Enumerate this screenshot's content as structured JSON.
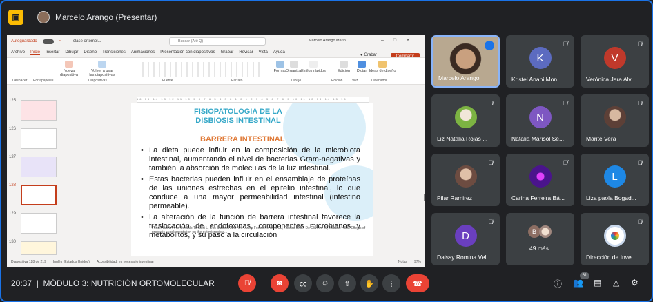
{
  "header": {
    "presenter_title": "Marcelo Arango (Presentar)"
  },
  "ppt": {
    "autosave": "Autoguardado",
    "filename": "clase ortomol...",
    "search_placeholder": "Buscar (Alt+Q)",
    "user": "Marcelo Arango Marin",
    "tabs": [
      "Archivo",
      "Inicio",
      "Insertar",
      "Dibujar",
      "Diseño",
      "Transiciones",
      "Animaciones",
      "Presentación con diapositivas",
      "Grabar",
      "Revisar",
      "Vista",
      "Ayuda"
    ],
    "record": "Grabar",
    "share": "Compartir",
    "ribbon_groups": [
      "Deshacer",
      "Portapapeles",
      "Diapositivas",
      "Fuente",
      "Párrafo",
      "Dibujo",
      "Edición",
      "Voz",
      "Diseñador"
    ],
    "ribbon_items": [
      "Nueva diapositiva",
      "Volver a usar las diapositivas",
      "Formas",
      "Organizar",
      "Estilos rápidos",
      "Edición",
      "Dictar",
      "Ideas de diseño"
    ],
    "slide_numbers": [
      "125",
      "126",
      "127",
      "128",
      "129",
      "130"
    ],
    "status": "Diapositiva 128 de 219",
    "status_lang": "Inglés (Estados Unidos)",
    "status_access": "Accesibilidad: es necesario investigar",
    "status_notes": "Notas",
    "zoom": "97%"
  },
  "slide": {
    "title_line1": "FISIOPATOLOGIA DE LA",
    "title_line2": "DISBIOSIS INTESTINAL",
    "subtitle": "BARRERA INTESTINAL",
    "bullet1": "La dieta puede influir en la composición de la microbiota intestinal, aumentando el nivel de bacterias Gram-negativas y también la absorción de moléculas de la luz intestinal.",
    "bullet2": "Estas bacterias pueden influir en el ensamblaje de proteínas de las uniones estrechas en el epitelio intestinal, lo que conduce a una mayor permeabilidad intestinal (intestino permeable).",
    "bullet3": "La alteración de la función de barrera intestinal favorece la traslocación de endotoxinas, componentes microbianos y metabolitos, y su paso a la circulación",
    "reference": "Fonte: Sant Anna, Bordalo Tonucci L, Dos Santos KMO, De Luces Fortes Ferreira CL, Ribeiro SMR, De Oliveira LL, Martino HSD. Effects of probiotic supplementation on the gut microbiota..."
  },
  "participants": [
    {
      "name": "Marcelo Arango",
      "initial": "",
      "color": "#6b5a4e"
    },
    {
      "name": "Kristel Anahi Mon...",
      "initial": "K",
      "color": "#5c6bc0"
    },
    {
      "name": "Verónica Jara Alv...",
      "initial": "V",
      "color": "#c0392b"
    },
    {
      "name": "Liz Natalia Rojas ...",
      "initial": "",
      "color": "#7cb342"
    },
    {
      "name": "Natalia Marisol Se...",
      "initial": "N",
      "color": "#7e57c2"
    },
    {
      "name": "Marité Vera",
      "initial": "",
      "color": "#8d6e63"
    },
    {
      "name": "Pilar Ramirez",
      "initial": "",
      "color": "#a1887f"
    },
    {
      "name": "Carina Ferreira Bá...",
      "initial": "",
      "color": "#4a148c"
    },
    {
      "name": "Liza paola Bogad...",
      "initial": "L",
      "color": "#1e88e5"
    },
    {
      "name": "Daissy Romina Vel...",
      "initial": "D",
      "color": "#6a3fbf"
    },
    {
      "name": "49 más",
      "initial": "B",
      "color": "#8d6e63"
    },
    {
      "name": "Dirección de Inve...",
      "initial": "",
      "color": "#ffffff"
    }
  ],
  "footer": {
    "time": "20:37",
    "separator": "|",
    "meeting": "MÓDULO 3: NUTRICIÓN ORTOMOLECULAR",
    "people_count": "61"
  },
  "colors": {
    "accent": "#1a73e8",
    "danger": "#ea4335",
    "tile_bg": "#3c4043"
  }
}
